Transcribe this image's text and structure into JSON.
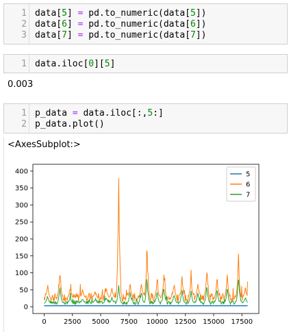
{
  "cells": [
    {
      "lines": [
        {
          "num": "1",
          "parts": [
            "data[",
            "5",
            "] ",
            "=",
            " pd.to_numeric(data[",
            "5",
            "])"
          ]
        },
        {
          "num": "2",
          "parts": [
            "data[",
            "6",
            "] ",
            "=",
            " pd.to_numeric(data[",
            "6",
            "])"
          ]
        },
        {
          "num": "3",
          "parts": [
            "data[",
            "7",
            "] ",
            "=",
            " pd.to_numeric(data[",
            "7",
            "])"
          ]
        }
      ]
    },
    {
      "lines": [
        {
          "num": "1",
          "parts": [
            "data.iloc[",
            "0",
            "][",
            "5",
            "]"
          ]
        }
      ],
      "output": "0.003"
    },
    {
      "lines": [
        {
          "num": "1",
          "parts": [
            "p_data ",
            "=",
            " data.iloc[:,",
            "5",
            ":]"
          ]
        },
        {
          "num": "2",
          "parts": [
            "p_data.plot()"
          ]
        }
      ],
      "output": "<AxesSubplot:>"
    }
  ],
  "colors": {
    "series_5": "#1f77b4",
    "series_6": "#ff7f0e",
    "series_7": "#2ca02c",
    "number": "#008800",
    "operator": "#aa22ff"
  },
  "chart_data": {
    "type": "line",
    "title": "",
    "xlabel": "",
    "ylabel": "",
    "xlim": [
      -1000,
      19000
    ],
    "ylim": [
      -20,
      420
    ],
    "xticks": [
      "0",
      "2500",
      "5000",
      "7500",
      "10000",
      "12500",
      "15000",
      "17500"
    ],
    "yticks": [
      "0",
      "50",
      "100",
      "150",
      "200",
      "250",
      "300",
      "350",
      "400"
    ],
    "legend_position": "top-right",
    "series": [
      {
        "name": "5",
        "baseline": 3,
        "points": [
          [
            0,
            3
          ],
          [
            18000,
            3
          ]
        ]
      },
      {
        "name": "6",
        "baseline": 28,
        "peaks": [
          [
            300,
            70
          ],
          [
            1400,
            120
          ],
          [
            2300,
            60
          ],
          [
            3400,
            55
          ],
          [
            4500,
            48
          ],
          [
            5500,
            65
          ],
          [
            6000,
            60
          ],
          [
            6600,
            402
          ],
          [
            7600,
            75
          ],
          [
            8600,
            80
          ],
          [
            9100,
            200
          ],
          [
            10000,
            85
          ],
          [
            10600,
            100
          ],
          [
            11500,
            78
          ],
          [
            12200,
            95
          ],
          [
            13000,
            90
          ],
          [
            13600,
            78
          ],
          [
            14400,
            125
          ],
          [
            15300,
            95
          ],
          [
            16200,
            100
          ],
          [
            17200,
            160
          ],
          [
            17800,
            60
          ]
        ]
      },
      {
        "name": "7",
        "baseline": 12,
        "peaks": [
          [
            300,
            35
          ],
          [
            1400,
            65
          ],
          [
            2300,
            30
          ],
          [
            3400,
            25
          ],
          [
            4500,
            22
          ],
          [
            5500,
            30
          ],
          [
            6000,
            28
          ],
          [
            6600,
            70
          ],
          [
            7600,
            45
          ],
          [
            8600,
            50
          ],
          [
            9100,
            95
          ],
          [
            10000,
            48
          ],
          [
            10600,
            60
          ],
          [
            11500,
            45
          ],
          [
            12200,
            55
          ],
          [
            13000,
            50
          ],
          [
            13600,
            45
          ],
          [
            14400,
            75
          ],
          [
            15300,
            55
          ],
          [
            16200,
            60
          ],
          [
            17200,
            108
          ],
          [
            17800,
            30
          ]
        ]
      }
    ]
  }
}
